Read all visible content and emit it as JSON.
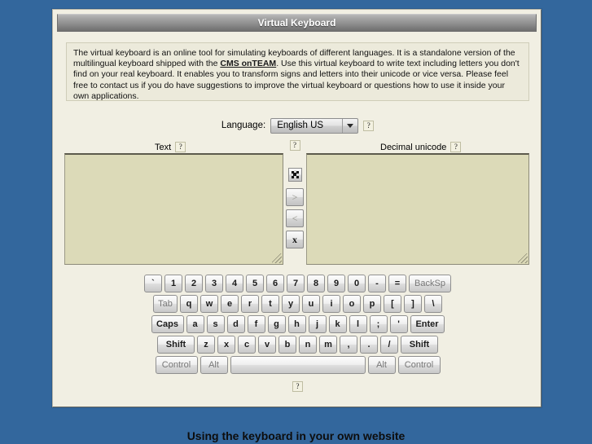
{
  "window": {
    "title": "Virtual Keyboard"
  },
  "description": {
    "part1": "The virtual keyboard is an online tool for simulating keyboards of different languages. It is a standalone version of the multilingual keyboard shipped with the ",
    "link": "CMS onTEAM",
    "part2": ". Use this virtual keyboard to write text including letters you don't find on your real keyboard. It enables you to transform signs and letters into their unicode or vice versa. Please feel free to contact us if you do have suggestions to improve the virtual keyboard or questions how to use it inside your own applications."
  },
  "language": {
    "label": "Language:",
    "selected": "English US",
    "options": [
      "English US"
    ],
    "help_label": "?"
  },
  "editor": {
    "text_label": "Text",
    "text_help_label": "?",
    "text_value": "",
    "unicode_label": "Decimal unicode",
    "unicode_help_label": "?",
    "unicode_value": "",
    "transfer_help_label": "?",
    "buttons": [
      {
        "name": "convert-icon-button",
        "label": "",
        "icon": "black-square-icon",
        "state": "enabled"
      },
      {
        "name": "to-unicode-button",
        "label": ">",
        "icon": "arrow-right-icon",
        "state": "disabled"
      },
      {
        "name": "to-text-button",
        "label": "<",
        "icon": "arrow-left-icon",
        "state": "disabled"
      },
      {
        "name": "clear-button",
        "label": "x",
        "icon": "clear-icon",
        "state": "enabled"
      }
    ]
  },
  "keyboard": {
    "help_label": "?",
    "rows": [
      [
        {
          "label": "`",
          "cls": ""
        },
        {
          "label": "1",
          "cls": ""
        },
        {
          "label": "2",
          "cls": ""
        },
        {
          "label": "3",
          "cls": ""
        },
        {
          "label": "4",
          "cls": ""
        },
        {
          "label": "5",
          "cls": ""
        },
        {
          "label": "6",
          "cls": ""
        },
        {
          "label": "7",
          "cls": ""
        },
        {
          "label": "8",
          "cls": ""
        },
        {
          "label": "9",
          "cls": ""
        },
        {
          "label": "0",
          "cls": ""
        },
        {
          "label": "-",
          "cls": ""
        },
        {
          "label": "=",
          "cls": ""
        },
        {
          "label": "BackSp",
          "cls": "mod wide-bs"
        }
      ],
      [
        {
          "label": "Tab",
          "cls": "mod wide-tab"
        },
        {
          "label": "q",
          "cls": ""
        },
        {
          "label": "w",
          "cls": ""
        },
        {
          "label": "e",
          "cls": ""
        },
        {
          "label": "r",
          "cls": ""
        },
        {
          "label": "t",
          "cls": ""
        },
        {
          "label": "y",
          "cls": ""
        },
        {
          "label": "u",
          "cls": ""
        },
        {
          "label": "i",
          "cls": ""
        },
        {
          "label": "o",
          "cls": ""
        },
        {
          "label": "p",
          "cls": ""
        },
        {
          "label": "[",
          "cls": ""
        },
        {
          "label": "]",
          "cls": ""
        },
        {
          "label": "\\",
          "cls": ""
        }
      ],
      [
        {
          "label": "Caps",
          "cls": "wide-caps"
        },
        {
          "label": "a",
          "cls": ""
        },
        {
          "label": "s",
          "cls": ""
        },
        {
          "label": "d",
          "cls": ""
        },
        {
          "label": "f",
          "cls": ""
        },
        {
          "label": "g",
          "cls": ""
        },
        {
          "label": "h",
          "cls": ""
        },
        {
          "label": "j",
          "cls": ""
        },
        {
          "label": "k",
          "cls": ""
        },
        {
          "label": "l",
          "cls": ""
        },
        {
          "label": ";",
          "cls": ""
        },
        {
          "label": "'",
          "cls": ""
        },
        {
          "label": "Enter",
          "cls": "wide-enter"
        }
      ],
      [
        {
          "label": "Shift",
          "cls": "wide-shift"
        },
        {
          "label": "z",
          "cls": ""
        },
        {
          "label": "x",
          "cls": ""
        },
        {
          "label": "c",
          "cls": ""
        },
        {
          "label": "v",
          "cls": ""
        },
        {
          "label": "b",
          "cls": ""
        },
        {
          "label": "n",
          "cls": ""
        },
        {
          "label": "m",
          "cls": ""
        },
        {
          "label": ",",
          "cls": ""
        },
        {
          "label": ".",
          "cls": ""
        },
        {
          "label": "/",
          "cls": ""
        },
        {
          "label": "Shift",
          "cls": "wide-shift"
        }
      ],
      [
        {
          "label": "Control",
          "cls": "mod wide-ctrl"
        },
        {
          "label": "Alt",
          "cls": "mod wide-alt"
        },
        {
          "label": "",
          "cls": "mod wide-space"
        },
        {
          "label": "Alt",
          "cls": "mod wide-alt"
        },
        {
          "label": "Control",
          "cls": "mod wide-ctrl"
        }
      ]
    ]
  },
  "footer": {
    "heading": "Using the keyboard in your own website"
  },
  "colors": {
    "page_background": "#33679d",
    "panel_background": "#f1efe3",
    "description_background": "#eceadb",
    "textarea_background": "#dcdab8",
    "title_bar_text": "#ffffff"
  }
}
